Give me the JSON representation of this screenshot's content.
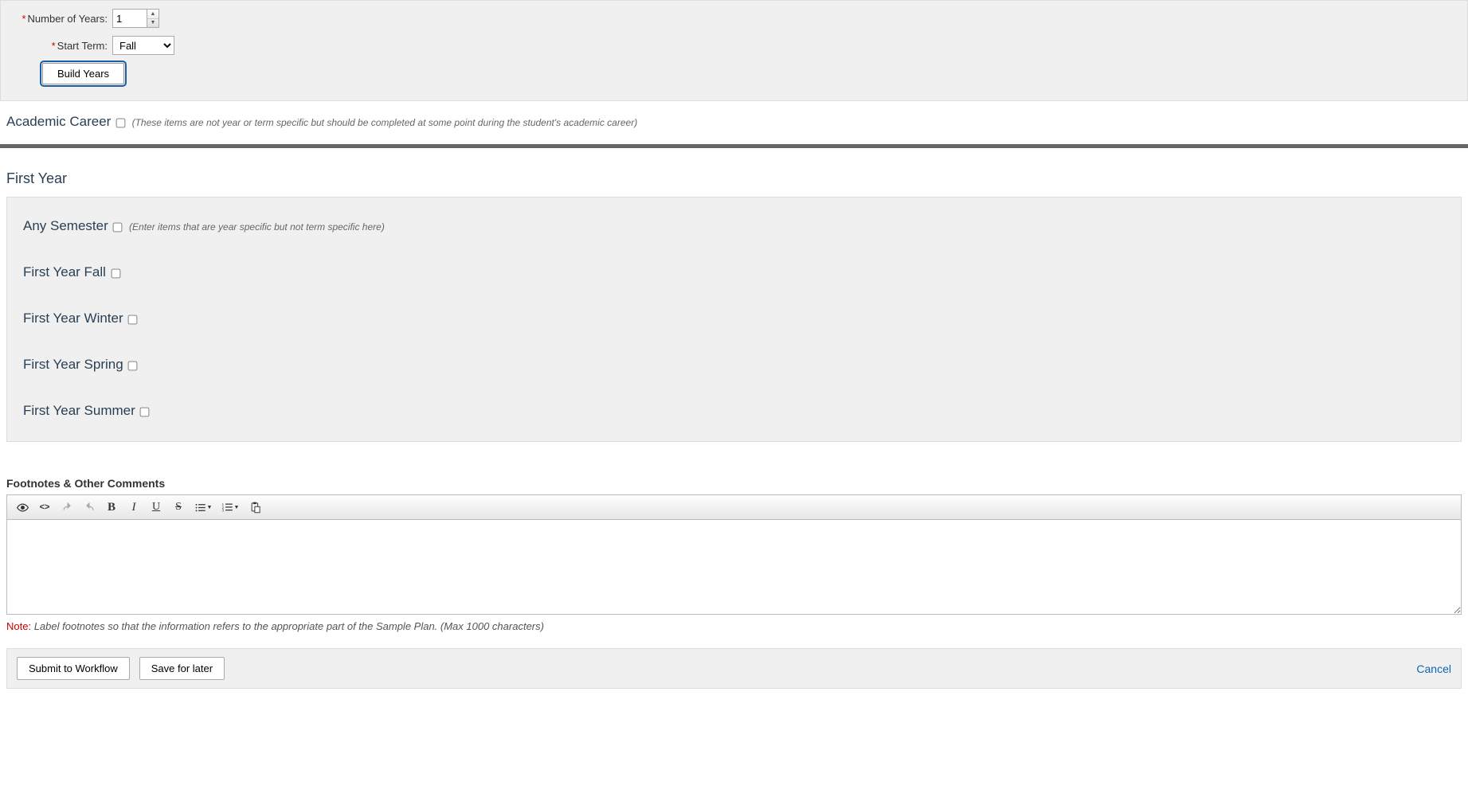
{
  "form": {
    "num_years_label": "Number of Years:",
    "num_years_value": "1",
    "start_term_label": "Start Term:",
    "start_term_value": "Fall",
    "build_button": "Build Years"
  },
  "academic_career": {
    "title": "Academic Career",
    "hint": "(These items are not year or term specific but should be completed at some point during the student's academic career)"
  },
  "year": {
    "header": "First Year",
    "any_semester_title": "Any Semester",
    "any_semester_hint": "(Enter items that are year specific but not term specific here)",
    "terms": [
      "First Year Fall",
      "First Year Winter",
      "First Year Spring",
      "First Year Summer"
    ]
  },
  "footnotes": {
    "label": "Footnotes & Other Comments",
    "note_label": "Note:",
    "note_text": "Label footnotes so that the information refers to the appropriate part of the Sample Plan. (Max 1000 characters)"
  },
  "actions": {
    "submit": "Submit to Workflow",
    "save": "Save for later",
    "cancel": "Cancel"
  }
}
